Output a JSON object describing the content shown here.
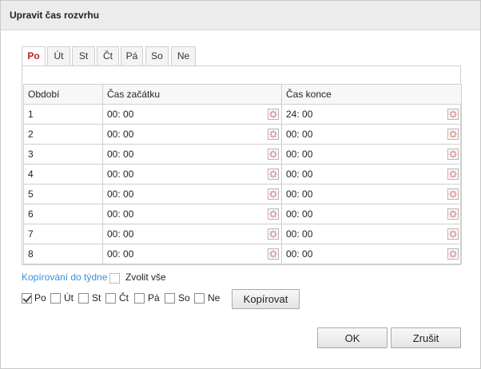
{
  "dialog": {
    "title": "Upravit čas rozvrhu"
  },
  "tabs": [
    {
      "label": "Po",
      "active": true
    },
    {
      "label": "Út"
    },
    {
      "label": "St"
    },
    {
      "label": "Čt"
    },
    {
      "label": "Pá"
    },
    {
      "label": "So"
    },
    {
      "label": "Ne"
    }
  ],
  "table": {
    "headers": {
      "period": "Období",
      "start": "Čas začátku",
      "end": "Čas konce"
    },
    "rows": [
      {
        "period": "1",
        "start": "00: 00",
        "end": "24: 00"
      },
      {
        "period": "2",
        "start": "00: 00",
        "end": "00: 00"
      },
      {
        "period": "3",
        "start": "00: 00",
        "end": "00: 00"
      },
      {
        "period": "4",
        "start": "00: 00",
        "end": "00: 00"
      },
      {
        "period": "5",
        "start": "00: 00",
        "end": "00: 00"
      },
      {
        "period": "6",
        "start": "00: 00",
        "end": "00: 00"
      },
      {
        "period": "7",
        "start": "00: 00",
        "end": "00: 00"
      },
      {
        "period": "8",
        "start": "00: 00",
        "end": "00: 00"
      }
    ],
    "picker_icon": "clock-icon"
  },
  "copy": {
    "link_label": "Kopírování do týdne",
    "select_all_label": "Zvolit vše",
    "select_all_checked": false,
    "days": [
      {
        "label": "Po",
        "checked": true
      },
      {
        "label": "Út",
        "checked": false
      },
      {
        "label": "St",
        "checked": false
      },
      {
        "label": "Čt",
        "checked": false
      },
      {
        "label": "Pá",
        "checked": false
      },
      {
        "label": "So",
        "checked": false
      },
      {
        "label": "Ne",
        "checked": false
      }
    ],
    "copy_button": "Kopírovat"
  },
  "footer": {
    "ok_label": "OK",
    "cancel_label": "Zrušit"
  },
  "colors": {
    "active_tab": "#c02020",
    "link": "#3a8fd8",
    "titlebar": "#ececec"
  }
}
